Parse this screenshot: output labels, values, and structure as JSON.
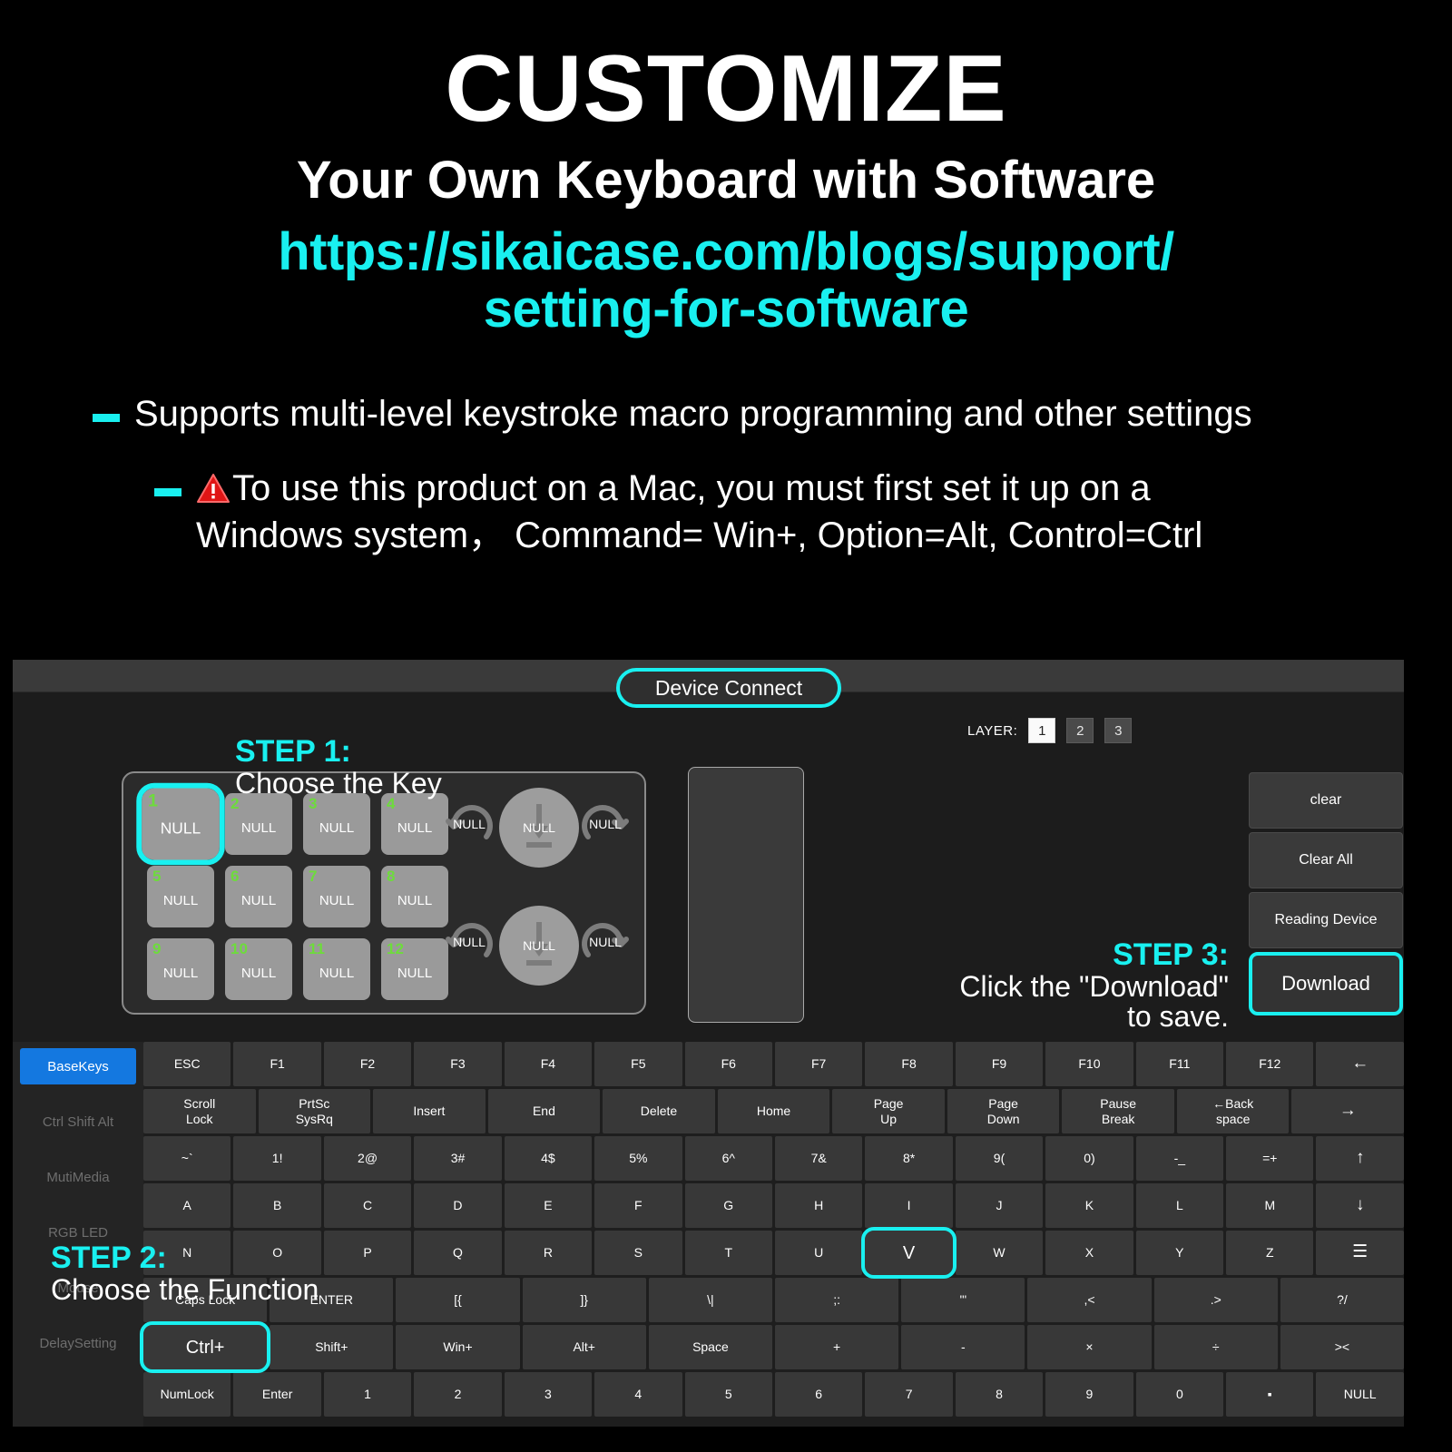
{
  "promo": {
    "title": "CUSTOMIZE",
    "subtitle": "Your Own Keyboard with Software",
    "url_line1": "https://sikaicase.com/blogs/support/",
    "url_line2": "setting-for-software",
    "bullet1": "Supports multi-level keystroke macro programming and other settings",
    "bullet2_line1": "To use this product on a Mac, you must first set it up on a",
    "bullet2_line2": "Windows system， Command= Win+, Option=Alt, Control=Ctrl",
    "accent_cyan": "#19F0F0",
    "warning_icon": "warning-triangle-icon"
  },
  "app": {
    "device_connect": "Device Connect",
    "layer_label": "LAYER:",
    "layers": [
      "1",
      "2",
      "3"
    ],
    "active_layer": "1",
    "keypad": {
      "keys": [
        {
          "index": "1",
          "value": "NULL",
          "selected": true
        },
        {
          "index": "2",
          "value": "NULL",
          "selected": false
        },
        {
          "index": "3",
          "value": "NULL",
          "selected": false
        },
        {
          "index": "4",
          "value": "NULL",
          "selected": false
        },
        {
          "index": "5",
          "value": "NULL",
          "selected": false
        },
        {
          "index": "6",
          "value": "NULL",
          "selected": false
        },
        {
          "index": "7",
          "value": "NULL",
          "selected": false
        },
        {
          "index": "8",
          "value": "NULL",
          "selected": false
        },
        {
          "index": "9",
          "value": "NULL",
          "selected": false
        },
        {
          "index": "10",
          "value": "NULL",
          "selected": false
        },
        {
          "index": "11",
          "value": "NULL",
          "selected": false
        },
        {
          "index": "12",
          "value": "NULL",
          "selected": false
        }
      ],
      "encoders": [
        {
          "ccw": "NULL",
          "press": "NULL",
          "cw": "NULL"
        },
        {
          "ccw": "NULL",
          "press": "NULL",
          "cw": "NULL"
        }
      ]
    },
    "actions": {
      "clear": "clear",
      "clear_all": "Clear All",
      "reading_device": "Reading Device",
      "download": "Download"
    },
    "steps": {
      "step1_num": "STEP 1:",
      "step1_txt": "Choose the Key",
      "step2_num": "STEP 2:",
      "step2_txt": "Choose the Function",
      "step3_num": "STEP 3:",
      "step3_txt1": "Click the \"Download\"",
      "step3_txt2": "to save."
    },
    "sidebar": {
      "items": [
        {
          "label": "BaseKeys",
          "active": true
        },
        {
          "label": "Ctrl Shift Alt",
          "active": false
        },
        {
          "label": "MutiMedia",
          "active": false
        },
        {
          "label": "RGB LED",
          "active": false
        },
        {
          "label": "Mouse",
          "active": false
        },
        {
          "label": "DelaySetting",
          "active": false
        }
      ]
    },
    "keyboard_rows": [
      [
        {
          "label": "ESC"
        },
        {
          "label": "F1"
        },
        {
          "label": "F2"
        },
        {
          "label": "F3"
        },
        {
          "label": "F4"
        },
        {
          "label": "F5"
        },
        {
          "label": "F6"
        },
        {
          "label": "F7"
        },
        {
          "label": "F8"
        },
        {
          "label": "F9"
        },
        {
          "label": "F10"
        },
        {
          "label": "F11"
        },
        {
          "label": "F12"
        },
        {
          "label": "←",
          "big": true
        }
      ],
      [
        {
          "label": "Scroll\nLock"
        },
        {
          "label": "PrtSc\nSysRq"
        },
        {
          "label": "Insert"
        },
        {
          "label": "End"
        },
        {
          "label": "Delete"
        },
        {
          "label": "Home"
        },
        {
          "label": "Page\nUp"
        },
        {
          "label": "Page\nDown"
        },
        {
          "label": "Pause\nBreak"
        },
        {
          "label": "←Back\nspace"
        },
        {
          "label": "→",
          "big": true
        }
      ],
      [
        {
          "label": "~`"
        },
        {
          "label": "1!"
        },
        {
          "label": "2@"
        },
        {
          "label": "3#"
        },
        {
          "label": "4$"
        },
        {
          "label": "5%"
        },
        {
          "label": "6^"
        },
        {
          "label": "7&"
        },
        {
          "label": "8*"
        },
        {
          "label": "9("
        },
        {
          "label": "0)"
        },
        {
          "label": "-_"
        },
        {
          "label": "=+"
        },
        {
          "label": "↑",
          "big": true
        }
      ],
      [
        {
          "label": "A"
        },
        {
          "label": "B"
        },
        {
          "label": "C"
        },
        {
          "label": "D"
        },
        {
          "label": "E"
        },
        {
          "label": "F"
        },
        {
          "label": "G"
        },
        {
          "label": "H"
        },
        {
          "label": "I"
        },
        {
          "label": "J"
        },
        {
          "label": "K"
        },
        {
          "label": "L"
        },
        {
          "label": "M"
        },
        {
          "label": "↓",
          "big": true
        }
      ],
      [
        {
          "label": "N"
        },
        {
          "label": "O"
        },
        {
          "label": "P"
        },
        {
          "label": "Q"
        },
        {
          "label": "R"
        },
        {
          "label": "S"
        },
        {
          "label": "T"
        },
        {
          "label": "U"
        },
        {
          "label": "V",
          "selected": true
        },
        {
          "label": "W"
        },
        {
          "label": "X"
        },
        {
          "label": "Y"
        },
        {
          "label": "Z"
        },
        {
          "label": "☰",
          "big": true
        }
      ],
      [
        {
          "label": "Caps Lock"
        },
        {
          "label": "ENTER"
        },
        {
          "label": "[{"
        },
        {
          "label": "]}"
        },
        {
          "label": "\\|"
        },
        {
          "label": ";:"
        },
        {
          "label": "'\""
        },
        {
          "label": ",<"
        },
        {
          "label": ".>"
        },
        {
          "label": "?/"
        }
      ],
      [
        {
          "label": "Ctrl+",
          "selected": true
        },
        {
          "label": "Shift+"
        },
        {
          "label": "Win+"
        },
        {
          "label": "Alt+"
        },
        {
          "label": "Space"
        },
        {
          "label": "+"
        },
        {
          "label": "-"
        },
        {
          "label": "×"
        },
        {
          "label": "÷"
        },
        {
          "label": "><"
        }
      ],
      [
        {
          "label": "NumLock"
        },
        {
          "label": "Enter"
        },
        {
          "label": "1"
        },
        {
          "label": "2"
        },
        {
          "label": "3"
        },
        {
          "label": "4"
        },
        {
          "label": "5"
        },
        {
          "label": "6"
        },
        {
          "label": "7"
        },
        {
          "label": "8"
        },
        {
          "label": "9"
        },
        {
          "label": "0"
        },
        {
          "label": "▪"
        },
        {
          "label": "NULL"
        }
      ]
    ]
  }
}
